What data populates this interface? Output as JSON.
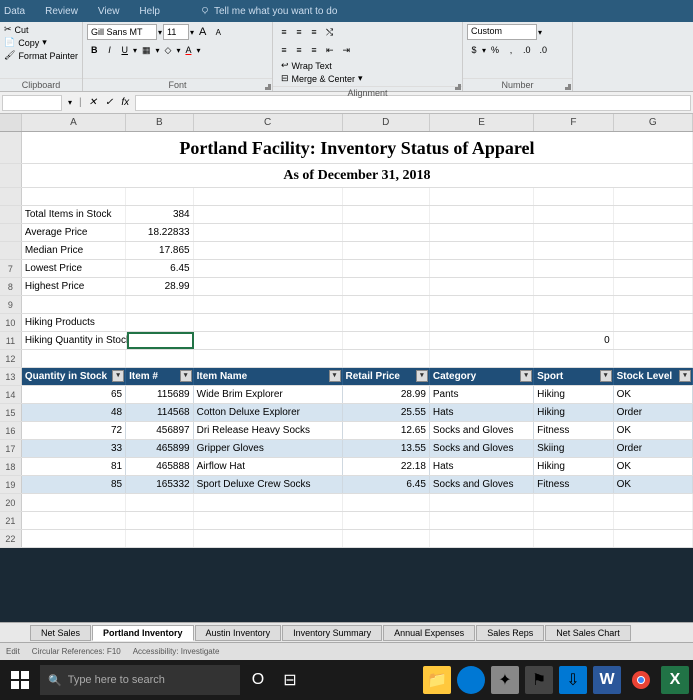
{
  "ribbon_tabs": {
    "data": "Data",
    "review": "Review",
    "view": "View",
    "help": "Help",
    "tell_me": "Tell me what you want to do"
  },
  "clipboard": {
    "cut": "Cut",
    "copy": "Copy",
    "format_painter": "Format Painter",
    "label": "Clipboard"
  },
  "font": {
    "name": "Gill Sans MT",
    "size": "11",
    "label": "Font",
    "grow": "A",
    "shrink": "A",
    "b": "B",
    "i": "I",
    "u": "U",
    "a": "A"
  },
  "alignment": {
    "wrap": "Wrap Text",
    "merge": "Merge & Center",
    "label": "Alignment"
  },
  "number": {
    "format": "Custom",
    "dollar": "$",
    "percent": "%",
    "comma": ",",
    "label": "Number"
  },
  "formula_bar": {
    "name_box": "",
    "check": "✓",
    "x": "✕",
    "fx": "fx"
  },
  "cols": {
    "A": "A",
    "B": "B",
    "C": "C",
    "D": "D",
    "E": "E",
    "F": "F",
    "G": "G"
  },
  "title": "Portland Facility: Inventory Status of Apparel",
  "subtitle": "As of December 31, 2018",
  "summary": {
    "r4": {
      "label": "Total Items in Stock",
      "val": "384"
    },
    "r5": {
      "label": "Average Price",
      "val": "18.22833"
    },
    "r6": {
      "label": "Median Price",
      "val": "17.865"
    },
    "r7": {
      "label": "Lowest Price",
      "val": "6.45"
    },
    "r8": {
      "label": "Highest Price",
      "val": "28.99"
    }
  },
  "r10": "Hiking Products",
  "r11": "Hiking Quantity in Stock",
  "r11f": "0",
  "headers": {
    "a": "Quantity in Stock",
    "b": "Item #",
    "c": "Item Name",
    "d": "Retail Price",
    "e": "Category",
    "f": "Sport",
    "g": "Stock Level"
  },
  "rows": [
    {
      "a": "65",
      "b": "115689",
      "c": "Wide Brim Explorer",
      "d": "28.99",
      "e": "Pants",
      "f": "Hiking",
      "g": "OK"
    },
    {
      "a": "48",
      "b": "114568",
      "c": "Cotton Deluxe Explorer",
      "d": "25.55",
      "e": "Hats",
      "f": "Hiking",
      "g": "Order"
    },
    {
      "a": "72",
      "b": "456897",
      "c": "Dri Release Heavy Socks",
      "d": "12.65",
      "e": "Socks and Gloves",
      "f": "Fitness",
      "g": "OK"
    },
    {
      "a": "33",
      "b": "465899",
      "c": "Gripper Gloves",
      "d": "13.55",
      "e": "Socks and Gloves",
      "f": "Skiing",
      "g": "Order"
    },
    {
      "a": "81",
      "b": "465888",
      "c": "Airflow Hat",
      "d": "22.18",
      "e": "Hats",
      "f": "Hiking",
      "g": "OK"
    },
    {
      "a": "85",
      "b": "165332",
      "c": "Sport Deluxe Crew Socks",
      "d": "6.45",
      "e": "Socks and Gloves",
      "f": "Fitness",
      "g": "OK"
    }
  ],
  "rownums": {
    "r4": "",
    "r5": "",
    "r6": "",
    "r7": "7",
    "r8": "8",
    "r9": "9",
    "r10": "10",
    "r11": "11",
    "r12": "12",
    "r13": "13",
    "r14": "14",
    "r15": "15",
    "r16": "16",
    "r17": "17",
    "r18": "18",
    "r19": "19",
    "r20": "20",
    "r21": "21",
    "r22": "22"
  },
  "tabs": {
    "net_sales": "Net Sales",
    "portland": "Portland Inventory",
    "austin": "Austin Inventory",
    "summary": "Inventory Summary",
    "annual": "Annual Expenses",
    "reps": "Sales Reps",
    "chart": "Net Sales Chart"
  },
  "status": {
    "edit": "Edit",
    "circ": "Circular References: F10",
    "acc": "Accessibility: Investigate"
  },
  "taskbar": {
    "search": "Type here to search"
  }
}
